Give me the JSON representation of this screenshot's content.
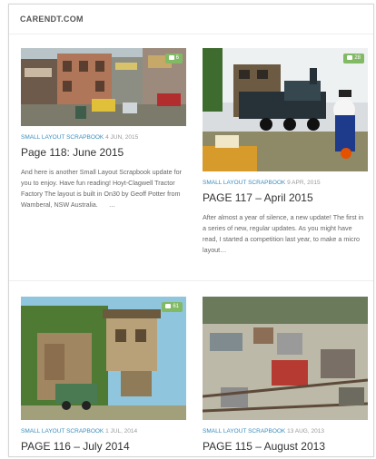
{
  "site": {
    "title": "CARENDT.COM"
  },
  "posts": [
    {
      "category": "SMALL LAYOUT SCRAPBOOK",
      "date": "4 JUN, 2015",
      "title": "Page 118: June 2015",
      "excerpt": "And here is another Small Layout Scrapbook update for you to enjoy. Have fun reading! Hoyt-Clagwell Tractor Factory The layout is built in On30 by Geoff Potter from Wamberal, NSW Australia.",
      "ellipsis": "…",
      "comments": "6"
    },
    {
      "category": "SMALL LAYOUT SCRAPBOOK",
      "date": "9 APR, 2015",
      "title": "PAGE 117 – April 2015",
      "excerpt": "After almost a year of silence, a new update! The first in a series of new, regular updates. As you might have read, I started a competition last year, to make a micro layout…",
      "comments": "28"
    },
    {
      "category": "SMALL LAYOUT SCRAPBOOK",
      "date": "1 JUL, 2014",
      "title": "PAGE 116 – July 2014",
      "comments": "61"
    },
    {
      "category": "SMALL LAYOUT SCRAPBOOK",
      "date": "13 AUG, 2013",
      "title": "PAGE 115 – August 2013"
    }
  ],
  "colors": {
    "accent": "#3b8dbd",
    "badge": "#82b965"
  }
}
